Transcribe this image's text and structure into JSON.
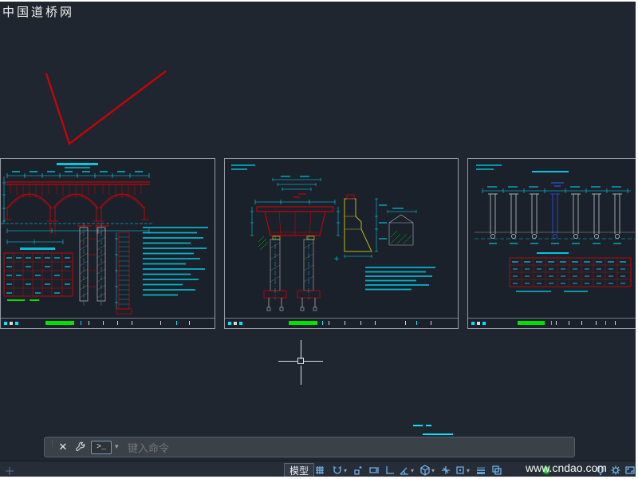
{
  "watermarks": {
    "top_left": "中国道桥网",
    "bottom_right": "www.cndao.com"
  },
  "command_bar": {
    "grip_glyph": "⋮",
    "close_glyph": "✕",
    "prompt_glyph": ">_",
    "caret": "▾",
    "placeholder": "键入命令"
  },
  "status_bar": {
    "model_label": "模型",
    "caret": "▾",
    "icons": [
      "grid-icon",
      "snap-mode-icon",
      "infer-constraints-icon",
      "dynamic-input-icon",
      "ortho-icon",
      "polar-tracking-icon",
      "isometric-drafting-icon",
      "osnap-tracking-icon",
      "object-snap-icon",
      "lineweight-icon",
      "selection-cycling-icon",
      "graphics-performance-icon",
      "isolate-objects-icon",
      "customization-gear-icon",
      "clean-screen-icon"
    ]
  },
  "colors": {
    "canvas_bg": "#20262f",
    "entity_red": "#e00000",
    "entity_cyan": "#00e5ff",
    "entity_green": "#00e000",
    "entity_yellow": "#b8b818",
    "entity_blue": "#3050e8",
    "status_icon_blue": "#6fb1ec"
  }
}
